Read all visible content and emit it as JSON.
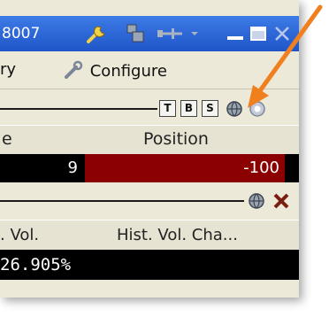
{
  "window": {
    "title_fragment": "8007"
  },
  "menu": {
    "partial_item": "ry",
    "configure_label": "Configure"
  },
  "toolbar": {
    "t_label": "T",
    "b_label": "B",
    "s_label": "S"
  },
  "table": {
    "col_left_fragment": "e",
    "col_position": "Position",
    "qty_value": "9",
    "position_value": "-100"
  },
  "vol_table": {
    "col_left_fragment": ". Vol.",
    "col_hist": "Hist. Vol. Cha...",
    "value": "26.905%"
  },
  "colors": {
    "title_bar": "#1f55c8",
    "position_cell": "#8b0000",
    "arrow": "#f07f1e"
  },
  "icons": [
    "wrench-icon",
    "group-icon",
    "pin-icon",
    "minimize-icon",
    "maximize-icon",
    "close-icon",
    "configure-icon",
    "globe-icon",
    "help-icon",
    "close-red-icon"
  ]
}
